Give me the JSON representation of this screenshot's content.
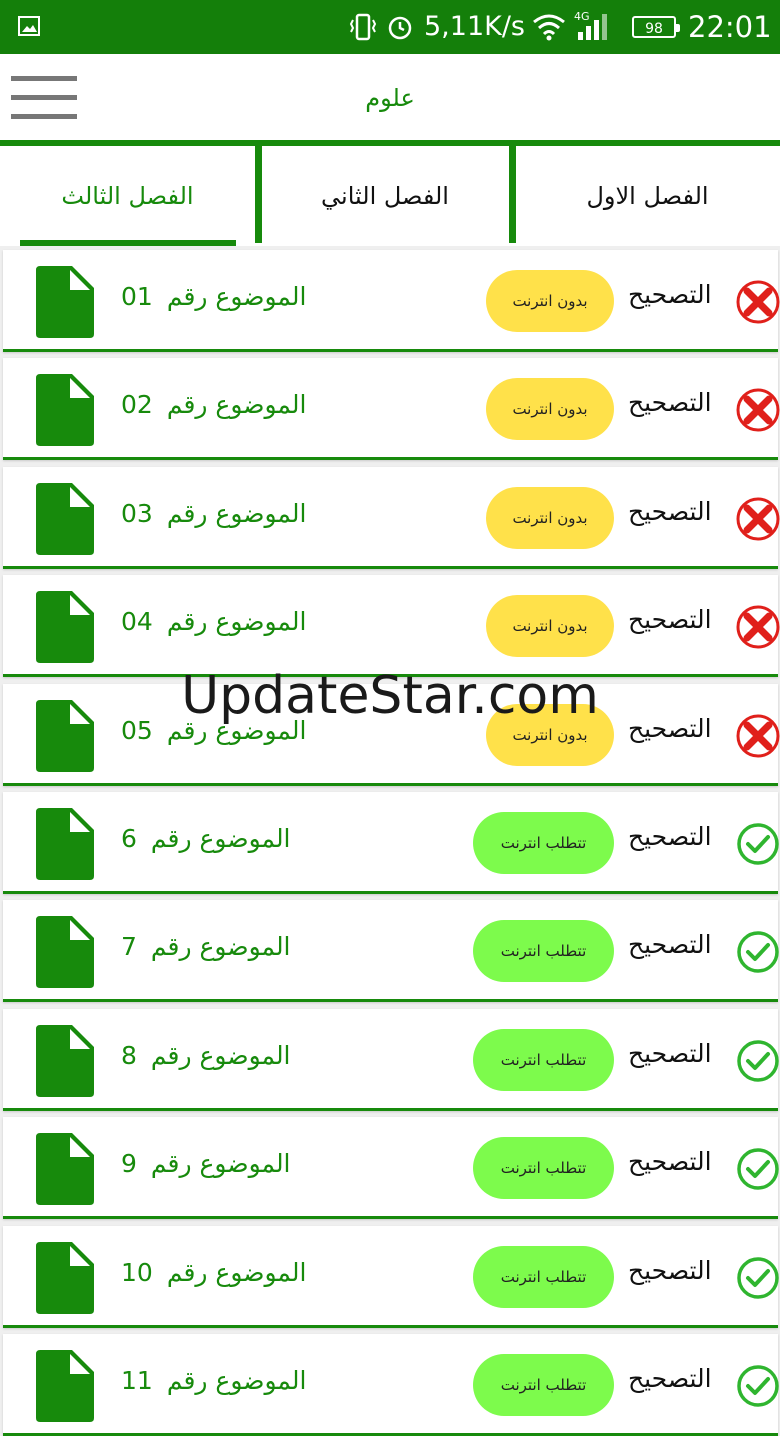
{
  "status_bar": {
    "speed": "5,11K/s",
    "network": "4G",
    "battery": "98",
    "time": "22:01",
    "icons": [
      "gallery-icon",
      "vibrate-icon",
      "alarm-icon",
      "wifi-icon",
      "signal-icon",
      "battery-icon"
    ]
  },
  "appbar": {
    "title": "علوم"
  },
  "tabs": [
    {
      "label": "الفصل الاول",
      "active": false
    },
    {
      "label": "الفصل الثاني",
      "active": false
    },
    {
      "label": "الفصل الثالث",
      "active": true
    }
  ],
  "topic_prefix": "الموضوع رقم",
  "correction_label": "التصحيح",
  "rows": [
    {
      "number": "01",
      "badge": "بدون انترنت",
      "type": "offline",
      "status": "x"
    },
    {
      "number": "02",
      "badge": "بدون انترنت",
      "type": "offline",
      "status": "x"
    },
    {
      "number": "03",
      "badge": "بدون انترنت",
      "type": "offline",
      "status": "x"
    },
    {
      "number": "04",
      "badge": "بدون انترنت",
      "type": "offline",
      "status": "x"
    },
    {
      "number": "05",
      "badge": "بدون انترنت",
      "type": "offline",
      "status": "x"
    },
    {
      "number": "6",
      "badge": "تتطلب انترنت",
      "type": "online",
      "status": "check"
    },
    {
      "number": "7",
      "badge": "تتطلب انترنت",
      "type": "online",
      "status": "check"
    },
    {
      "number": "8",
      "badge": "تتطلب انترنت",
      "type": "online",
      "status": "check"
    },
    {
      "number": "9",
      "badge": "تتطلب انترنت",
      "type": "online",
      "status": "check"
    },
    {
      "number": "10",
      "badge": "تتطلب انترنت",
      "type": "online",
      "status": "check"
    },
    {
      "number": "11",
      "badge": "تتطلب انترنت",
      "type": "online",
      "status": "check"
    }
  ],
  "watermark": "UpdateStar.com",
  "colors": {
    "primary": "#178a0c",
    "offline_badge": "#ffe14a",
    "online_badge": "#7dfb4c",
    "error": "#e0201b",
    "success": "#2fb52f"
  }
}
